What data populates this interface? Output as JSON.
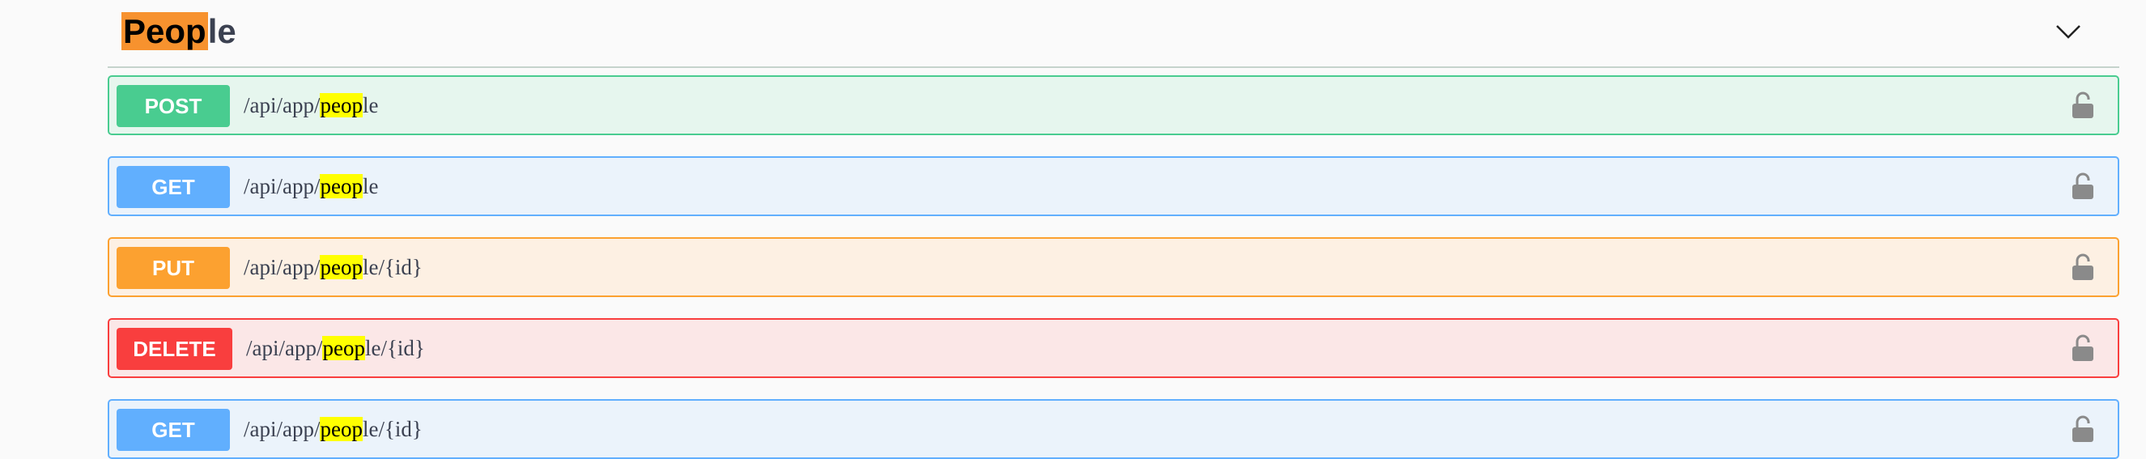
{
  "tag": {
    "title_highlight": "Peop",
    "title_rest": "le"
  },
  "operations": [
    {
      "method": "POST",
      "path_prefix": "/api/app/",
      "path_highlight": "peop",
      "path_suffix": "le",
      "color": "#49cc90",
      "lock_icon": "unlocked-padlock-icon"
    },
    {
      "method": "GET",
      "path_prefix": "/api/app/",
      "path_highlight": "peop",
      "path_suffix": "le",
      "color": "#61affe",
      "lock_icon": "unlocked-padlock-icon"
    },
    {
      "method": "PUT",
      "path_prefix": "/api/app/",
      "path_highlight": "peop",
      "path_suffix": "le/{id}",
      "color": "#fca130",
      "lock_icon": "unlocked-padlock-icon"
    },
    {
      "method": "DELETE",
      "path_prefix": "/api/app/",
      "path_highlight": "peop",
      "path_suffix": "le/{id}",
      "color": "#f93e3e",
      "lock_icon": "unlocked-padlock-icon"
    },
    {
      "method": "GET",
      "path_prefix": "/api/app/",
      "path_highlight": "peop",
      "path_suffix": "le/{id}",
      "color": "#61affe",
      "lock_icon": "unlocked-padlock-icon"
    }
  ],
  "icons": {
    "collapse": "chevron-down-icon"
  }
}
